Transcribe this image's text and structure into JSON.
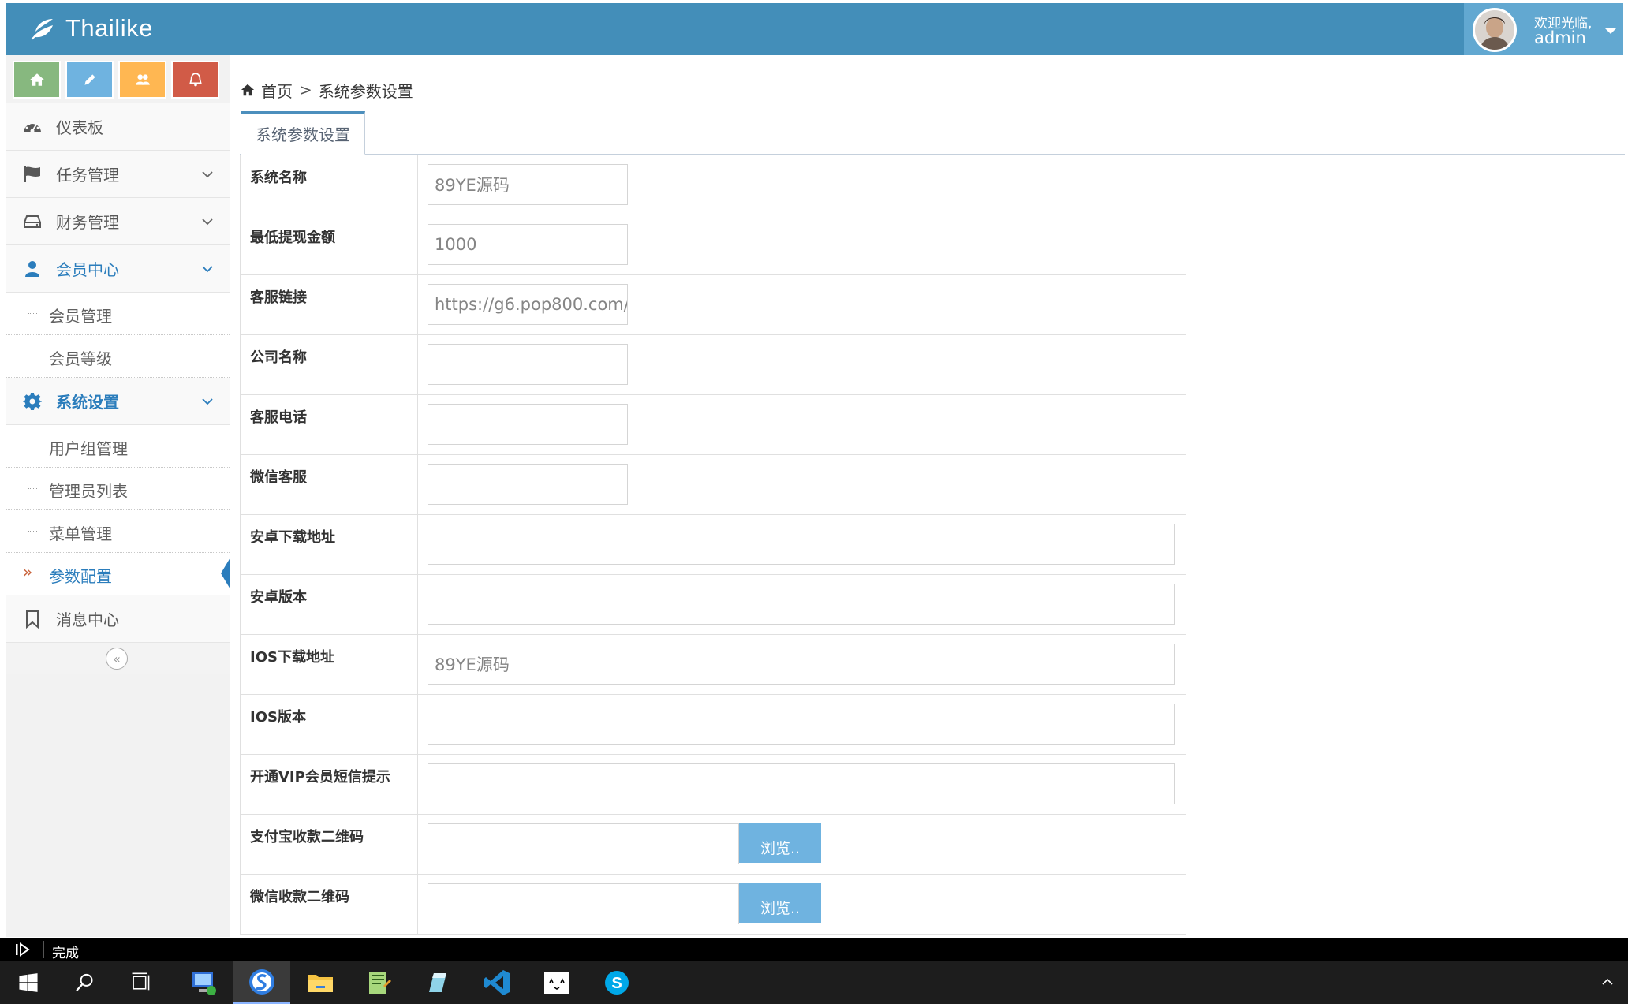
{
  "header": {
    "brand": "Thailike",
    "welcome": "欢迎光临,",
    "username": "admin"
  },
  "sidebar": {
    "shortcuts": [
      {
        "icon": "home-icon",
        "color": "#87b87f"
      },
      {
        "icon": "pencil-icon",
        "color": "#6fb3e0"
      },
      {
        "icon": "users-icon",
        "color": "#ffb752"
      },
      {
        "icon": "bell-icon",
        "color": "#d15b47"
      }
    ],
    "items": [
      {
        "label": "仪表板",
        "icon": "dashboard-icon"
      },
      {
        "label": "任务管理",
        "icon": "flag-icon"
      },
      {
        "label": "财务管理",
        "icon": "hdd-icon"
      },
      {
        "label": "会员中心",
        "icon": "user-icon",
        "open": true,
        "children": [
          {
            "label": "会员管理"
          },
          {
            "label": "会员等级"
          }
        ]
      },
      {
        "label": "系统设置",
        "icon": "cog-icon",
        "open": true,
        "children": [
          {
            "label": "用户组管理"
          },
          {
            "label": "管理员列表"
          },
          {
            "label": "菜单管理"
          },
          {
            "label": "参数配置",
            "active": true
          }
        ]
      },
      {
        "label": "消息中心",
        "icon": "bookmark-icon"
      }
    ],
    "collapse_symbol": "«"
  },
  "breadcrumb": {
    "home": "首页",
    "separator": ">",
    "current": "系统参数设置"
  },
  "tabs": [
    {
      "label": "系统参数设置",
      "active": true
    }
  ],
  "form": {
    "rows": [
      {
        "label": "系统名称",
        "value": "89YE源码"
      },
      {
        "label": "最低提现金额",
        "value": "1000"
      },
      {
        "label": "客服链接",
        "value": "https://g6.pop800.com/"
      },
      {
        "label": "公司名称",
        "value": ""
      },
      {
        "label": "客服电话",
        "value": ""
      },
      {
        "label": "微信客服",
        "value": ""
      },
      {
        "label": "安卓下载地址",
        "value": ""
      },
      {
        "label": "安卓版本",
        "value": ""
      },
      {
        "label": "IOS下载地址",
        "value": "89YE源码"
      },
      {
        "label": "IOS版本",
        "value": ""
      },
      {
        "label": "开通VIP会员短信提示",
        "value": ""
      },
      {
        "label": "支付宝收款二维码",
        "value": "",
        "button": "浏览.."
      },
      {
        "label": "微信收款二维码",
        "value": "",
        "button": "浏览.."
      }
    ]
  },
  "statusbar": {
    "text": "完成"
  },
  "taskbar": {
    "items": [
      "start-icon",
      "search-icon",
      "task-view-icon",
      "network-app-icon",
      "sogou-browser-icon",
      "file-explorer-icon",
      "notepad-icon",
      "edit-app-icon",
      "vscode-icon",
      "cat-app-icon",
      "skype-icon"
    ]
  },
  "colors": {
    "header": "#438eb9",
    "user_box": "#62a8d1",
    "accent": "#2b7dbc",
    "active_arrow": "#c86139",
    "browse_button": "#6fb3e0"
  }
}
